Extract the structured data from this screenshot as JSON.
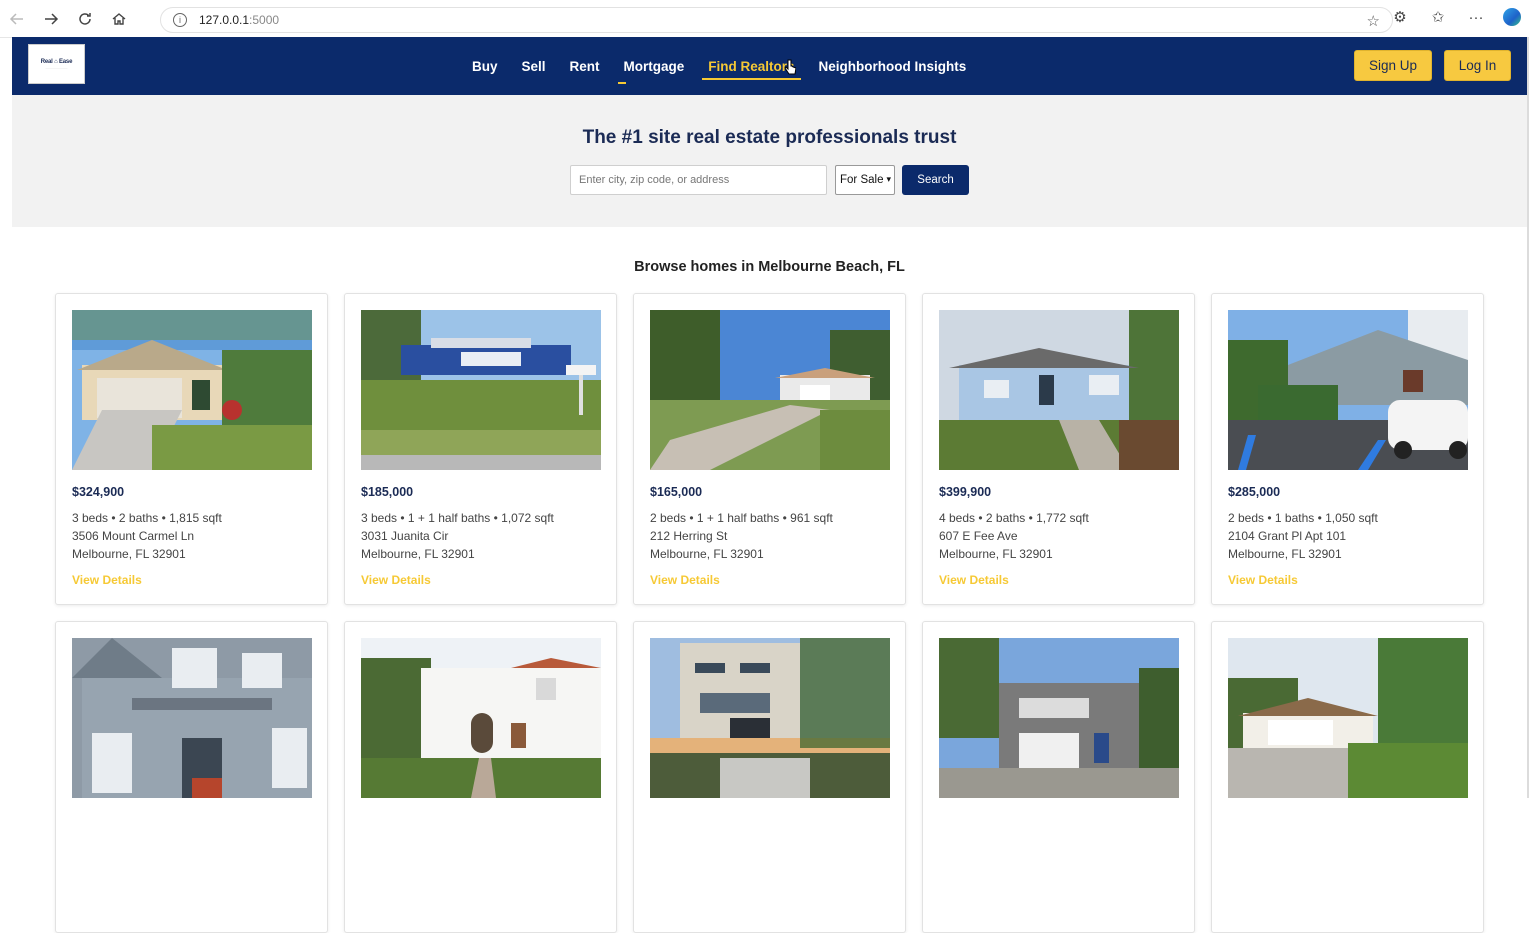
{
  "browser": {
    "url_host": "127.0.0.1",
    "url_port": ":5000"
  },
  "header": {
    "logo_text": "Real ⌂ Ease",
    "nav": [
      {
        "label": "Buy"
      },
      {
        "label": "Sell"
      },
      {
        "label": "Rent"
      },
      {
        "label": "Mortgage"
      },
      {
        "label": "Find Realtors"
      },
      {
        "label": "Neighborhood Insights"
      }
    ],
    "signup_label": "Sign Up",
    "login_label": "Log In"
  },
  "hero": {
    "title": "The #1 site real estate professionals trust",
    "search_placeholder": "Enter city, zip code, or address",
    "filter_value": "For Sale",
    "search_label": "Search"
  },
  "browse": {
    "title": "Browse homes in Melbourne Beach, FL",
    "details_label": "View Details",
    "listings": [
      {
        "price": "$324,900",
        "meta": "3 beds • 2 baths • 1,815 sqft",
        "street": "3506 Mount Carmel Ln",
        "city": "Melbourne, FL 32901"
      },
      {
        "price": "$185,000",
        "meta": "3 beds • 1 + 1 half baths • 1,072 sqft",
        "street": "3031 Juanita Cir",
        "city": "Melbourne, FL 32901"
      },
      {
        "price": "$165,000",
        "meta": "2 beds • 1 + 1 half baths • 961 sqft",
        "street": "212 Herring St",
        "city": "Melbourne, FL 32901"
      },
      {
        "price": "$399,900",
        "meta": "4 beds • 2 baths • 1,772 sqft",
        "street": "607 E Fee Ave",
        "city": "Melbourne, FL 32901"
      },
      {
        "price": "$285,000",
        "meta": "2 beds • 1 baths • 1,050 sqft",
        "street": "2104 Grant Pl Apt 101",
        "city": "Melbourne, FL 32901"
      }
    ]
  },
  "colors": {
    "navy": "#0b2a6b",
    "accent": "#f6c935"
  }
}
